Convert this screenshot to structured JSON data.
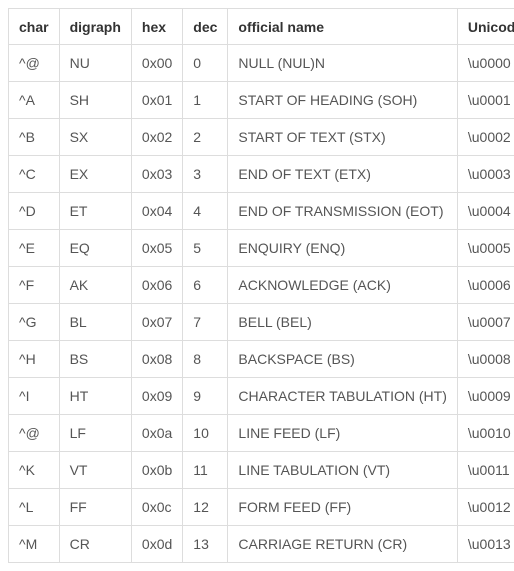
{
  "table": {
    "headers": [
      "char",
      "digraph",
      "hex",
      "dec",
      "official name",
      "Unicode"
    ],
    "rows": [
      {
        "char": "^@",
        "digraph": "NU",
        "hex": "0x00",
        "dec": "0",
        "name": "NULL (NUL)N",
        "unicode": "\\u0000"
      },
      {
        "char": "^A",
        "digraph": "SH",
        "hex": "0x01",
        "dec": "1",
        "name": "START OF HEADING (SOH)",
        "unicode": "\\u0001"
      },
      {
        "char": "^B",
        "digraph": "SX",
        "hex": "0x02",
        "dec": "2",
        "name": "START OF TEXT (STX)",
        "unicode": "\\u0002"
      },
      {
        "char": "^C",
        "digraph": "EX",
        "hex": "0x03",
        "dec": "3",
        "name": "END OF TEXT (ETX)",
        "unicode": "\\u0003"
      },
      {
        "char": "^D",
        "digraph": "ET",
        "hex": "0x04",
        "dec": "4",
        "name": "END OF TRANSMISSION (EOT)",
        "unicode": "\\u0004"
      },
      {
        "char": "^E",
        "digraph": "EQ",
        "hex": "0x05",
        "dec": "5",
        "name": "ENQUIRY (ENQ)",
        "unicode": "\\u0005"
      },
      {
        "char": "^F",
        "digraph": "AK",
        "hex": "0x06",
        "dec": "6",
        "name": "ACKNOWLEDGE (ACK)",
        "unicode": "\\u0006"
      },
      {
        "char": "^G",
        "digraph": "BL",
        "hex": "0x07",
        "dec": "7",
        "name": "BELL (BEL)",
        "unicode": "\\u0007"
      },
      {
        "char": "^H",
        "digraph": "BS",
        "hex": "0x08",
        "dec": "8",
        "name": "BACKSPACE (BS)",
        "unicode": "\\u0008"
      },
      {
        "char": "^I",
        "digraph": "HT",
        "hex": "0x09",
        "dec": "9",
        "name": "CHARACTER TABULATION (HT)",
        "unicode": "\\u0009"
      },
      {
        "char": "^@",
        "digraph": "LF",
        "hex": "0x0a",
        "dec": "10",
        "name": "LINE FEED (LF)",
        "unicode": "\\u0010"
      },
      {
        "char": "^K",
        "digraph": "VT",
        "hex": "0x0b",
        "dec": "11",
        "name": "LINE TABULATION (VT)",
        "unicode": "\\u0011"
      },
      {
        "char": "^L",
        "digraph": "FF",
        "hex": "0x0c",
        "dec": "12",
        "name": "FORM FEED (FF)",
        "unicode": "\\u0012"
      },
      {
        "char": "^M",
        "digraph": "CR",
        "hex": "0x0d",
        "dec": "13",
        "name": "CARRIAGE RETURN (CR)",
        "unicode": "\\u0013"
      }
    ]
  }
}
